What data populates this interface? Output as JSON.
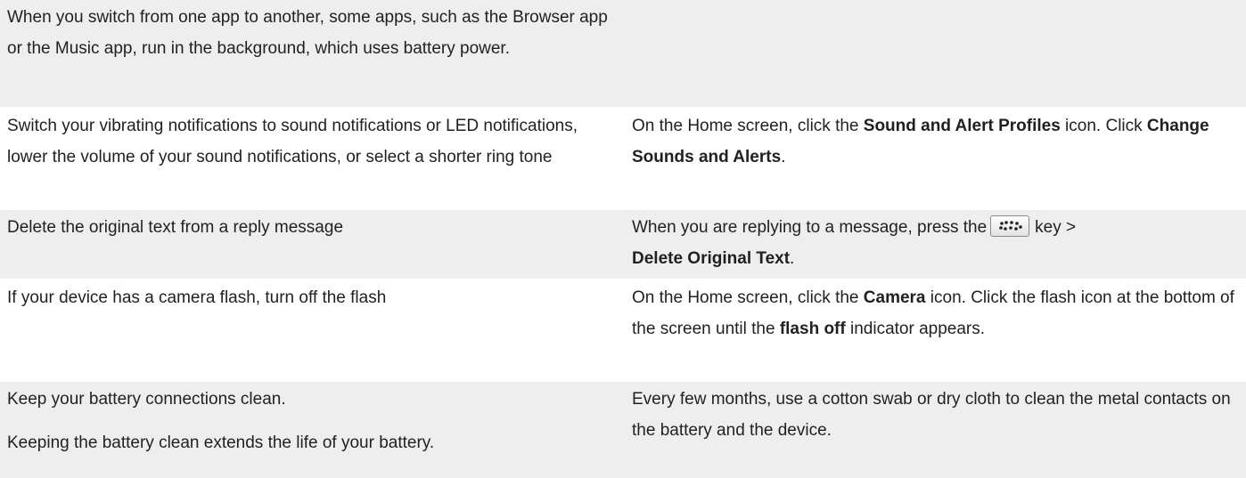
{
  "rows": [
    {
      "left": "When you switch from one app to another, some apps, such as the Browser app or the Music app, run in the background, which uses battery power.",
      "right": ""
    },
    {
      "left": "Switch your vibrating notifications to sound notifications or LED notifications, lower the volume of your sound notifications, or select a shorter ring tone",
      "right": {
        "t1": "On the Home screen, click the ",
        "b1": "Sound and Alert Profiles",
        "t2": " icon. Click ",
        "b2": "Change Sounds and Alerts",
        "t3": "."
      }
    },
    {
      "left": "Delete the original text from a reply message",
      "right": {
        "t1": "When you are replying to a message, press the",
        "key_icon": "blackberry-menu-key-icon",
        "t2": "key >",
        "b1": "Delete Original Text",
        "t3": "."
      }
    },
    {
      "left": "If your device has a camera flash, turn off the flash",
      "right": {
        "t1": "On the Home screen, click the ",
        "b1": "Camera",
        "t2": " icon. Click the flash icon at the bottom of the screen until the ",
        "b2": "flash off",
        "t3": " indicator appears."
      }
    },
    {
      "left_p1": "Keep your battery connections clean.",
      "left_p2": "Keeping the battery clean extends the life of your battery.",
      "right": "Every few months, use a cotton swab or dry cloth to clean the metal contacts on the battery and the device."
    }
  ]
}
